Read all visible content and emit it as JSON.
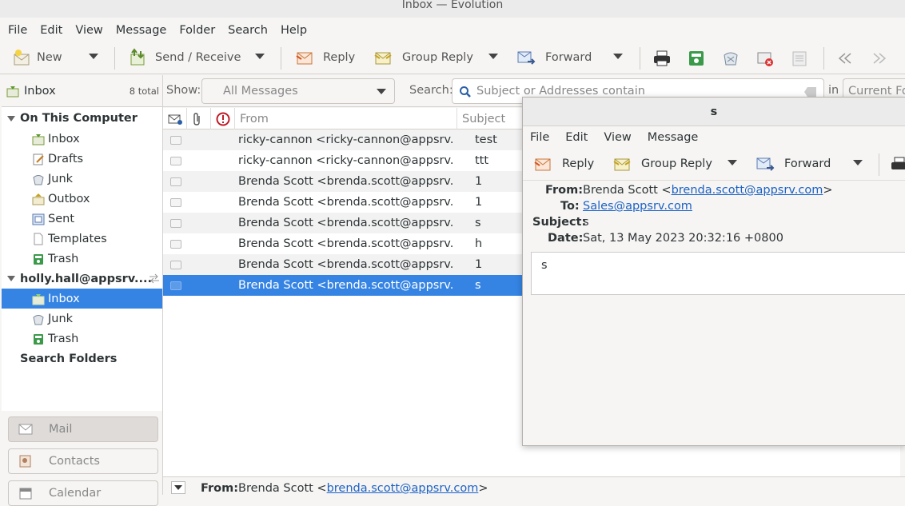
{
  "window": {
    "title": "Inbox — Evolution"
  },
  "menu": [
    "File",
    "Edit",
    "View",
    "Message",
    "Folder",
    "Search",
    "Help"
  ],
  "toolbar": {
    "new": "New",
    "send_receive": "Send / Receive",
    "reply": "Reply",
    "group_reply": "Group Reply",
    "forward": "Forward"
  },
  "sidebar": {
    "header": "Inbox",
    "count": "8 total",
    "accounts": [
      {
        "name": "On This Computer",
        "folders": [
          "Inbox",
          "Drafts",
          "Junk",
          "Outbox",
          "Sent",
          "Templates",
          "Trash"
        ]
      },
      {
        "name": "holly.hall@appsrv....",
        "folders": [
          "Inbox",
          "Junk",
          "Trash"
        ]
      }
    ],
    "search_folders": "Search Folders",
    "switchers": [
      "Mail",
      "Contacts",
      "Calendar"
    ]
  },
  "filter": {
    "show_label": "Show:",
    "show_value": "All Messages",
    "search_label": "Search:",
    "search_placeholder": "Subject or Addresses contain",
    "in_label": "in",
    "scope": "Current Fo"
  },
  "columns": {
    "from": "From",
    "subject": "Subject"
  },
  "messages": [
    {
      "from": "ricky-cannon <ricky-cannon@appsrv.c...",
      "subject": "test"
    },
    {
      "from": "ricky-cannon <ricky-cannon@appsrv.c...",
      "subject": "ttt"
    },
    {
      "from": "Brenda Scott <brenda.scott@appsrv.co...",
      "subject": "1"
    },
    {
      "from": "Brenda Scott <brenda.scott@appsrv.co...",
      "subject": "1"
    },
    {
      "from": "Brenda Scott <brenda.scott@appsrv.co...",
      "subject": "s"
    },
    {
      "from": "Brenda Scott <brenda.scott@appsrv.co...",
      "subject": "h"
    },
    {
      "from": "Brenda Scott <brenda.scott@appsrv.co...",
      "subject": "1"
    },
    {
      "from": "Brenda Scott <brenda.scott@appsrv.co...",
      "subject": "s"
    }
  ],
  "preview": {
    "from_label": "From:",
    "from_name": "Brenda Scott <",
    "from_email": "brenda.scott@appsrv.com",
    "from_close": ">"
  },
  "message_window": {
    "title": "s",
    "menu": [
      "File",
      "Edit",
      "View",
      "Message"
    ],
    "reply": "Reply",
    "group_reply": "Group Reply",
    "forward": "Forward",
    "from_label": "From:",
    "from_name": "Brenda Scott <",
    "from_email": "brenda.scott@appsrv.com",
    "from_close": ">",
    "to_label": "To:",
    "to_email": "Sales@appsrv.com",
    "subject_label": "Subject:",
    "subject": "s",
    "date_label": "Date:",
    "date": "Sat, 13 May 2023 20:32:16 +0800",
    "body": "s"
  },
  "colors": {
    "selection": "#3584e4",
    "link": "#1c62c4"
  }
}
